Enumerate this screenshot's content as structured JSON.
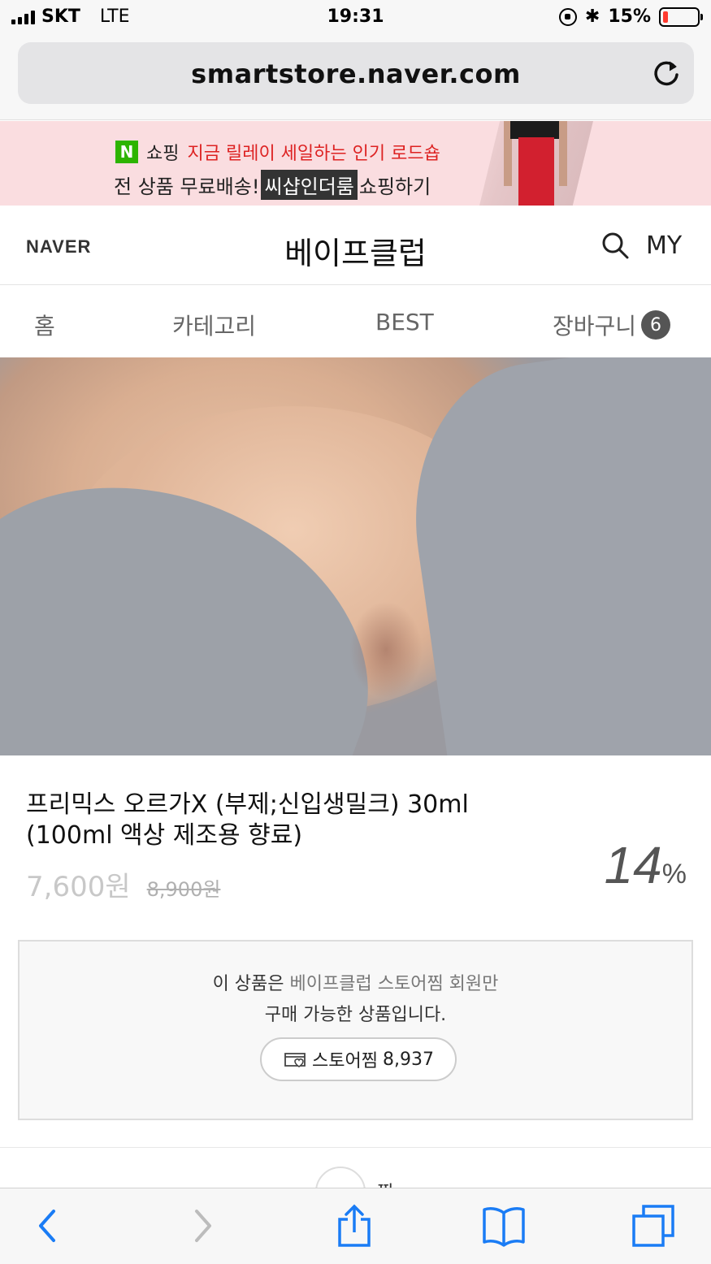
{
  "status_bar": {
    "carrier": "SKT",
    "network": "LTE",
    "time": "19:31",
    "bluetooth_symbol": "✱",
    "battery": "15%",
    "battery_level": 0.15
  },
  "browser": {
    "url": "smartstore.naver.com"
  },
  "banner": {
    "badge": "N",
    "shopping_label": "쇼핑",
    "promo_text": "지금 릴레이 세일하는 인기 로드숍",
    "line2_prefix": "전 상품 무료배송!",
    "brand": "씨샵인더룸",
    "line2_suffix": "쇼핑하기"
  },
  "header": {
    "logo": "NAVER",
    "store_name": "베이프클럽",
    "my_label": "MY"
  },
  "tabs": {
    "home": "홈",
    "category": "카테고리",
    "best": "BEST",
    "cart": "장바구니",
    "cart_count": "6"
  },
  "product": {
    "title": "프리믹스 오르가X (부제;신입생밀크) 30ml (100ml 액상 제조용 향료)",
    "price": "7,600원",
    "original_price": "8,900원",
    "discount": "14",
    "discount_unit": "%"
  },
  "member_box": {
    "msg_prefix": "이 상품은 ",
    "msg_store": "베이프클럽 스토어찜 회원만",
    "msg_line2": "구매 가능한 상품입니다.",
    "follow_label": "스토어찜",
    "follow_count": "8,937"
  },
  "peek": {
    "text": "찜"
  },
  "colors": {
    "accent_green": "#2db400",
    "banner_bg": "#fadde0",
    "promo_red": "#d22222",
    "ios_blue": "#1a7cf5"
  }
}
